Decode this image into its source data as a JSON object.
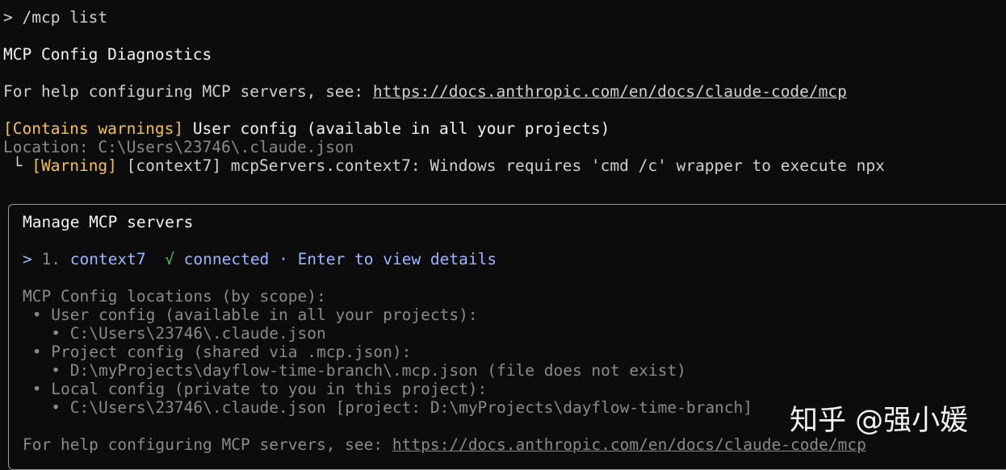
{
  "prompt": {
    "symbol": ">",
    "command": "/mcp list"
  },
  "diagnostics": {
    "title": "MCP Config Diagnostics",
    "help_prefix": "For help configuring MCP servers, see: ",
    "help_url": "https://docs.anthropic.com/en/docs/claude-code/mcp",
    "warning_tag": "[Contains warnings]",
    "scope_desc": "User config (available in all your projects)",
    "location": "Location: C:\\Users\\23746\\.claude.json",
    "tree_glyph": "└",
    "warning_label": "[Warning]",
    "warning_message": "[context7] mcpServers.context7: Windows requires 'cmd /c' wrapper to execute npx"
  },
  "manage": {
    "title": "Manage MCP servers",
    "selection_marker": ">",
    "server": {
      "index": "1.",
      "name": "context7",
      "status_icon": "√",
      "status": "connected",
      "separator": "·",
      "hint": "Enter to view details"
    },
    "locations_header": "MCP Config locations (by scope):",
    "scopes": [
      {
        "label": "User config (available in all your projects):",
        "path": "C:\\Users\\23746\\.claude.json"
      },
      {
        "label": "Project config (shared via .mcp.json):",
        "path": "D:\\myProjects\\dayflow-time-branch\\.mcp.json (file does not exist)"
      },
      {
        "label": "Local config (private to you in this project):",
        "path": "C:\\Users\\23746\\.claude.json [project: D:\\myProjects\\dayflow-time-branch]"
      }
    ],
    "bullet": "•",
    "help_prefix": "For help configuring MCP servers, see: ",
    "help_url": "https://docs.anthropic.com/en/docs/claude-code/mcp"
  },
  "watermark": "知乎 @强小媛",
  "colors": {
    "background": "#0c0c0c",
    "warning": "#f5c242",
    "connected": "#3fc35e",
    "selected": "#9ab6ff",
    "dim": "#8a8a8a"
  }
}
